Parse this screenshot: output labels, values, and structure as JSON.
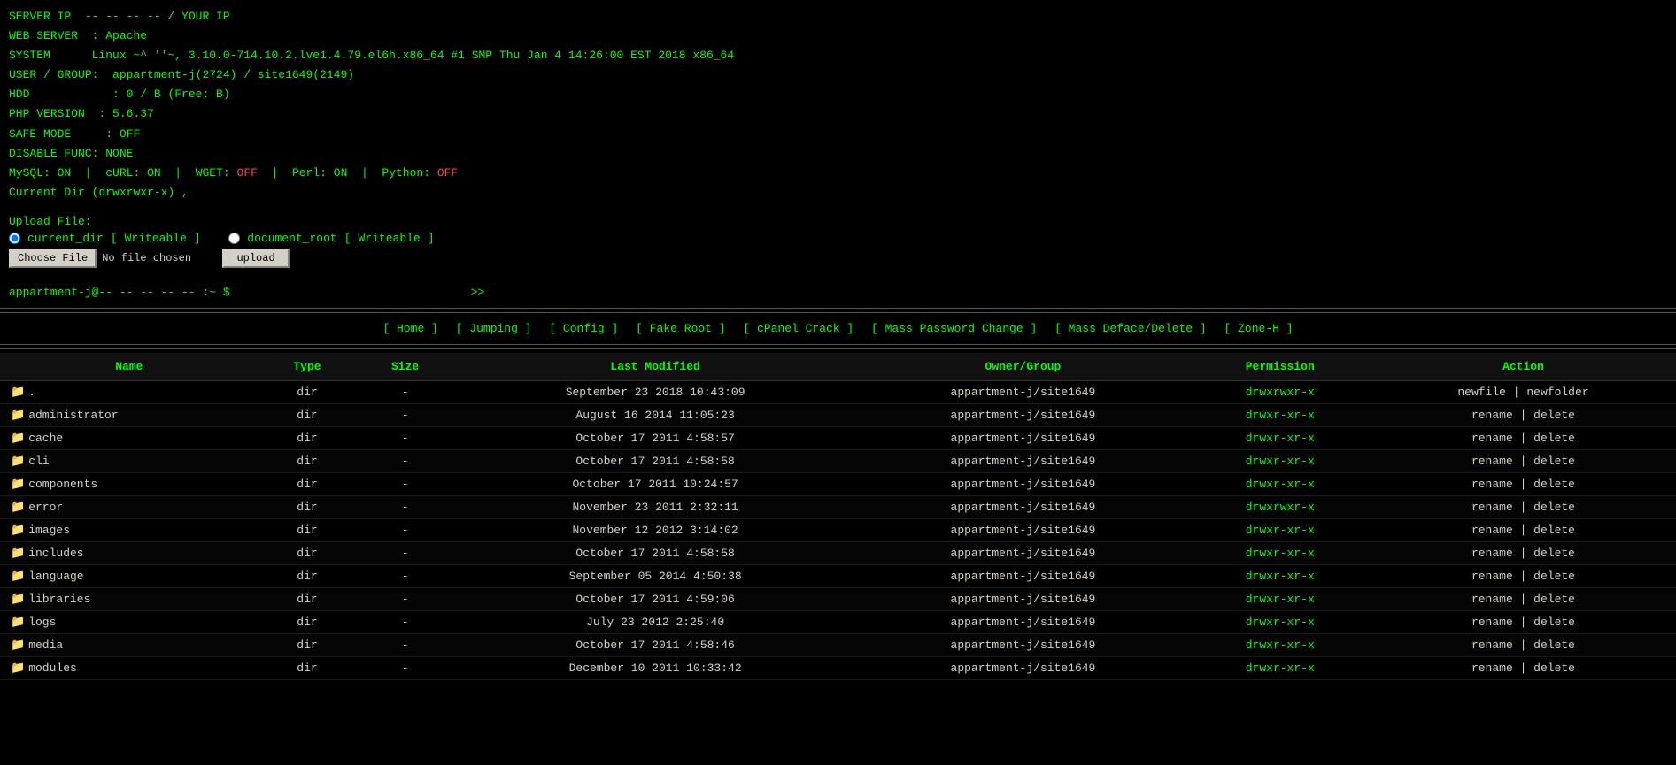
{
  "server": {
    "server_ip_label": "SERVER IP",
    "server_ip_value": "-- -- -- --  / YOUR IP",
    "web_server_label": "WEB SERVER",
    "web_server_value": "Apache",
    "system_label": "SYSTEM",
    "system_value": "Linux  ~^   ''~,    3.10.0-714.10.2.lve1.4.79.el6h.x86_64 #1 SMP Thu Jan 4 14:26:00 EST 2018 x86_64",
    "user_group_label": "USER / GROUP:",
    "user_group_value": "appartment-j(2724) / site1649(2149)",
    "hdd_label": "HDD",
    "hdd_value": ": 0 /  B (Free:  B)",
    "php_label": "PHP VERSION",
    "php_value": ": 5.6.37",
    "safe_mode_label": "SAFE MODE",
    "safe_mode_value": ": OFF",
    "disable_func_label": "DISABLE FUNC:",
    "disable_func_value": "NONE",
    "mysql_label": "MySQL:",
    "mysql_value": "ON",
    "curl_label": "cURL:",
    "curl_value": "ON",
    "wget_label": "WGET:",
    "wget_value": "OFF",
    "perl_label": "Perl:",
    "perl_value": "ON",
    "python_label": "Python:",
    "python_value": "OFF",
    "current_dir_label": "Current Dir",
    "current_dir_value": "(drwxrwxr-x) ,"
  },
  "upload": {
    "label": "Upload File:",
    "radio1_label": "current_dir",
    "radio1_bracket_open": "[",
    "radio1_writeable": "Writeable",
    "radio1_bracket_close": "]",
    "radio2_label": "document_root",
    "radio2_bracket_open": "[",
    "radio2_writeable": "Writeable",
    "radio2_bracket_close": "]",
    "choose_file_btn": "Choose File",
    "no_file_text": "No file chosen",
    "upload_btn": "upload"
  },
  "terminal": {
    "prompt": "appartment-j@-- -- -- -- -- :~ $",
    "input_value": "",
    "submit_label": ">>"
  },
  "nav": {
    "items": [
      {
        "label": "[ Home ]"
      },
      {
        "label": "[ Jumping ]"
      },
      {
        "label": "[ Config ]"
      },
      {
        "label": "[ Fake Root ]"
      },
      {
        "label": "[ cPanel Crack ]"
      },
      {
        "label": "[ Mass Password Change ]"
      },
      {
        "label": "[ Mass Deface/Delete ]"
      },
      {
        "label": "[ Zone-H ]"
      }
    ]
  },
  "table": {
    "columns": [
      "Name",
      "Type",
      "Size",
      "Last Modified",
      "Owner/Group",
      "Permission",
      "Action"
    ],
    "rows": [
      {
        "name": ".",
        "type": "dir",
        "size": "-",
        "modified": "September 23 2018 10:43:09",
        "owner": "appartment-j/site1649",
        "perm": "drwxrwxr-x",
        "action": "newfile | newfolder"
      },
      {
        "name": "administrator",
        "type": "dir",
        "size": "-",
        "modified": "August 16 2014 11:05:23",
        "owner": "appartment-j/site1649",
        "perm": "drwxr-xr-x",
        "action": "rename | delete"
      },
      {
        "name": "cache",
        "type": "dir",
        "size": "-",
        "modified": "October 17 2011 4:58:57",
        "owner": "appartment-j/site1649",
        "perm": "drwxr-xr-x",
        "action": "rename | delete"
      },
      {
        "name": "cli",
        "type": "dir",
        "size": "-",
        "modified": "October 17 2011 4:58:58",
        "owner": "appartment-j/site1649",
        "perm": "drwxr-xr-x",
        "action": "rename | delete"
      },
      {
        "name": "components",
        "type": "dir",
        "size": "-",
        "modified": "October 17 2011 10:24:57",
        "owner": "appartment-j/site1649",
        "perm": "drwxr-xr-x",
        "action": "rename | delete"
      },
      {
        "name": "error",
        "type": "dir",
        "size": "-",
        "modified": "November 23 2011 2:32:11",
        "owner": "appartment-j/site1649",
        "perm": "drwxrwxr-x",
        "action": "rename | delete"
      },
      {
        "name": "images",
        "type": "dir",
        "size": "-",
        "modified": "November 12 2012 3:14:02",
        "owner": "appartment-j/site1649",
        "perm": "drwxr-xr-x",
        "action": "rename | delete"
      },
      {
        "name": "includes",
        "type": "dir",
        "size": "-",
        "modified": "October 17 2011 4:58:58",
        "owner": "appartment-j/site1649",
        "perm": "drwxr-xr-x",
        "action": "rename | delete"
      },
      {
        "name": "language",
        "type": "dir",
        "size": "-",
        "modified": "September 05 2014 4:50:38",
        "owner": "appartment-j/site1649",
        "perm": "drwxr-xr-x",
        "action": "rename | delete"
      },
      {
        "name": "libraries",
        "type": "dir",
        "size": "-",
        "modified": "October 17 2011 4:59:06",
        "owner": "appartment-j/site1649",
        "perm": "drwxr-xr-x",
        "action": "rename | delete"
      },
      {
        "name": "logs",
        "type": "dir",
        "size": "-",
        "modified": "July 23 2012 2:25:40",
        "owner": "appartment-j/site1649",
        "perm": "drwxr-xr-x",
        "action": "rename | delete"
      },
      {
        "name": "media",
        "type": "dir",
        "size": "-",
        "modified": "October 17 2011 4:58:46",
        "owner": "appartment-j/site1649",
        "perm": "drwxr-xr-x",
        "action": "rename | delete"
      },
      {
        "name": "modules",
        "type": "dir",
        "size": "-",
        "modified": "December 10 2011 10:33:42",
        "owner": "appartment-j/site1649",
        "perm": "drwxr-xr-x",
        "action": "rename | delete"
      }
    ]
  }
}
